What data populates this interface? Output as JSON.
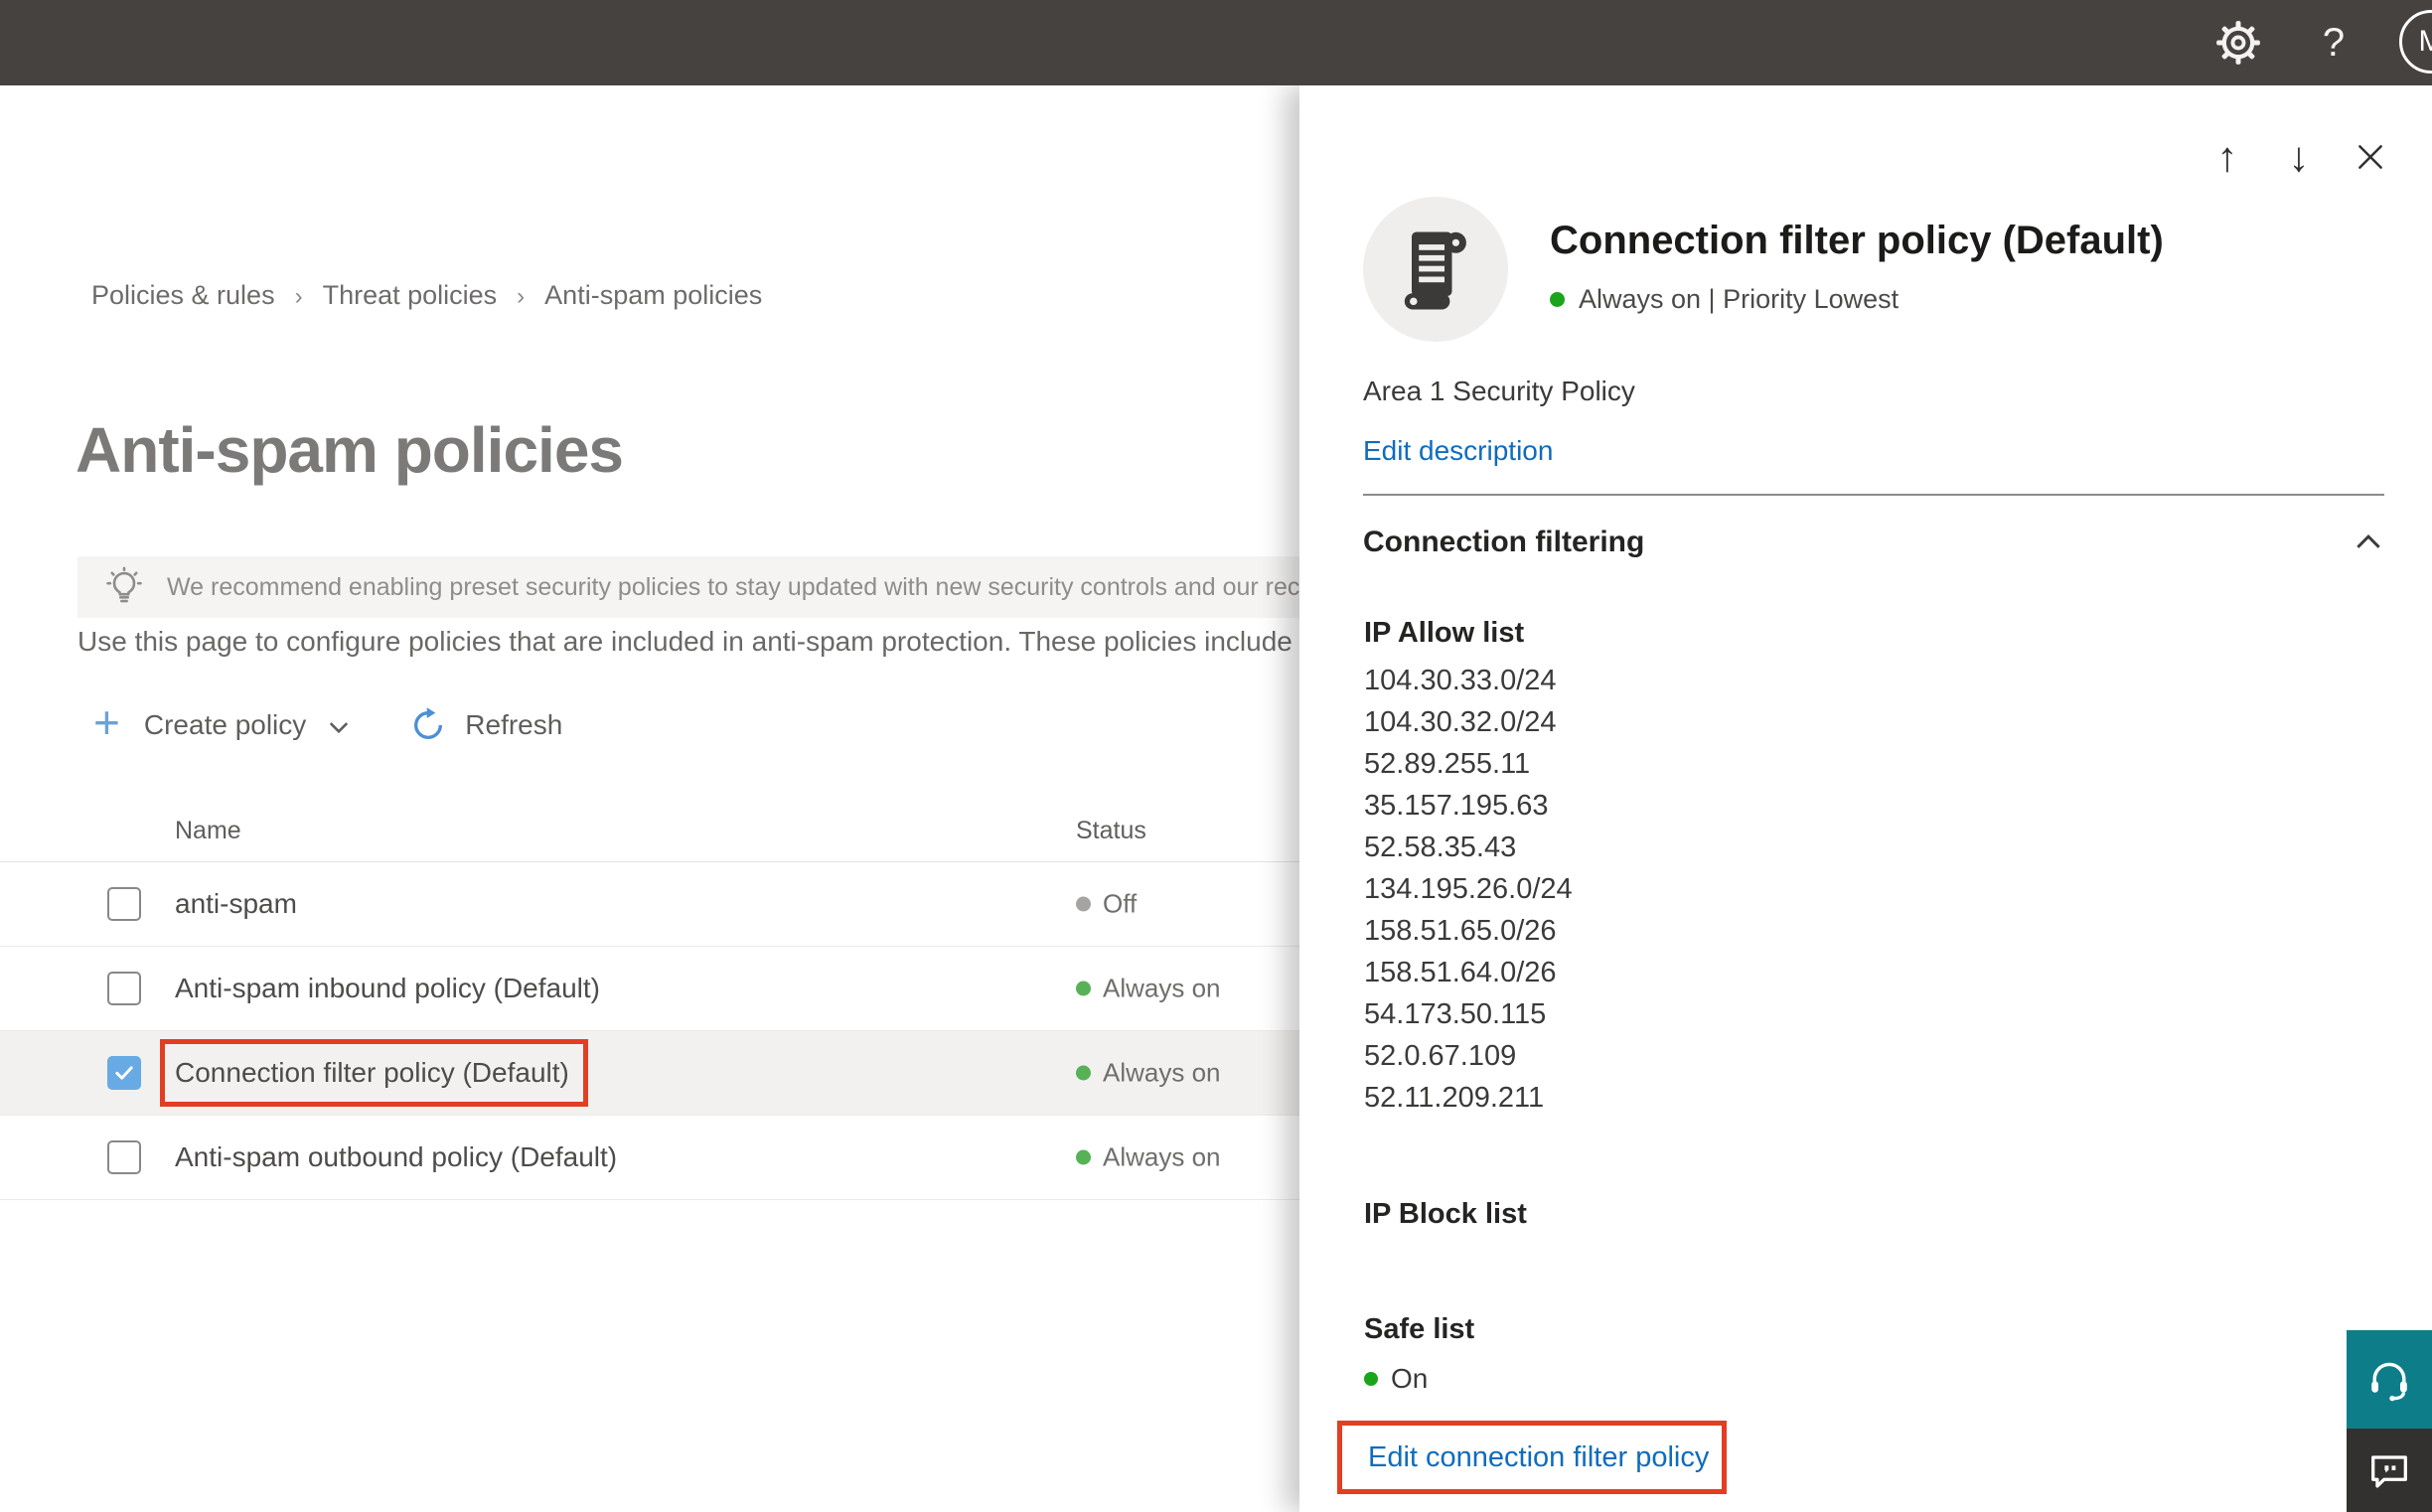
{
  "topbar": {
    "help_glyph": "?",
    "avatar_initial": "M"
  },
  "breadcrumb": {
    "items": [
      "Policies & rules",
      "Threat policies",
      "Anti-spam policies"
    ],
    "separator": "›"
  },
  "page": {
    "title": "Anti-spam policies",
    "banner_text": "We recommend enabling preset security policies to stay updated with new security controls and our recomme",
    "intro_text": "Use this page to configure policies that are included in anti-spam protection. These policies include",
    "toolbar": {
      "create_label": "Create policy",
      "plus_glyph": "+",
      "refresh_label": "Refresh"
    },
    "table": {
      "columns": [
        "Name",
        "Status"
      ],
      "rows": [
        {
          "name": "anti-spam",
          "status": "Off",
          "status_color": "#a6a4a2",
          "checked": false,
          "selected": false
        },
        {
          "name": "Anti-spam inbound policy (Default)",
          "status": "Always on",
          "status_color": "#57b257",
          "checked": false,
          "selected": false
        },
        {
          "name": "Connection filter policy (Default)",
          "status": "Always on",
          "status_color": "#57b257",
          "checked": true,
          "selected": true
        },
        {
          "name": "Anti-spam outbound policy (Default)",
          "status": "Always on",
          "status_color": "#57b257",
          "checked": false,
          "selected": false
        }
      ]
    }
  },
  "panel": {
    "nav": {
      "up_glyph": "↑",
      "down_glyph": "↓"
    },
    "title": "Connection filter policy (Default)",
    "status_text": "Always on | Priority Lowest",
    "status_color": "#1aa51a",
    "description": "Area 1 Security Policy",
    "edit_description_label": "Edit description",
    "section_title": "Connection filtering",
    "ip_allow_title": "IP Allow list",
    "ip_allow_items": [
      "104.30.33.0/24",
      "104.30.32.0/24",
      "52.89.255.11",
      "35.157.195.63",
      "52.58.35.43",
      "134.195.26.0/24",
      "158.51.65.0/26",
      "158.51.64.0/26",
      "54.173.50.115",
      "52.0.67.109",
      "52.11.209.211"
    ],
    "ip_block_title": "IP Block list",
    "safe_list_title": "Safe list",
    "safe_list_status": "On",
    "safe_list_status_color": "#1aa51a",
    "edit_link_label": "Edit connection filter policy"
  },
  "colors": {
    "accent_link": "#0f6cbd",
    "annotation_red": "#e23e23",
    "topbar_bg": "#454240",
    "teal_button": "#0d7e89"
  }
}
